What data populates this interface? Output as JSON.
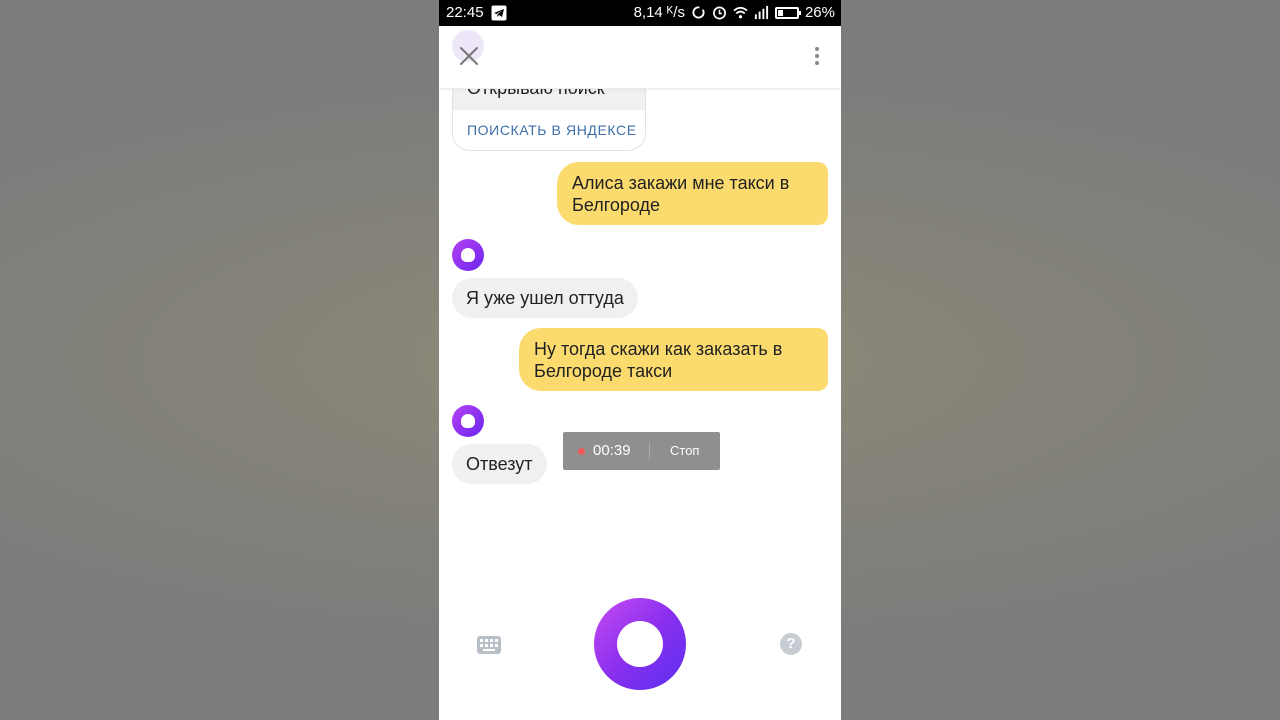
{
  "status_bar": {
    "time": "22:45",
    "speed": "8,14 ᴷ/s",
    "battery": "26%",
    "battery_level": 0.26,
    "icons": [
      "telegram-icon",
      "sync-icon",
      "alarm-icon",
      "wifi-icon",
      "signal-icon",
      "battery-icon"
    ]
  },
  "header": {
    "close_icon": "close-icon",
    "menu_icon": "more-vertical-icon"
  },
  "chat": {
    "search_card": {
      "text": "Открываю поиск",
      "link": "ПОИСКАТЬ В ЯНДЕКСЕ"
    },
    "messages": [
      {
        "from": "user",
        "text": "Алиса закажи мне такси в Белгороде"
      },
      {
        "from": "alisa",
        "text": "Я уже ушел оттуда"
      },
      {
        "from": "user",
        "text": "Ну тогда скажи как заказать в Белгороде такси"
      },
      {
        "from": "alisa",
        "text": "Отвезут"
      }
    ]
  },
  "recording": {
    "time": "00:39",
    "stop_label": "Стоп"
  },
  "bottom": {
    "keyboard_icon": "keyboard-icon",
    "mic_icon": "alisa-voice-icon",
    "help_label": "?"
  },
  "colors": {
    "user_bubble": "#fbdb6e",
    "bot_bubble": "#eef0f2",
    "accent_purple": "#8a2fee",
    "link_blue": "#3d6fa8"
  }
}
